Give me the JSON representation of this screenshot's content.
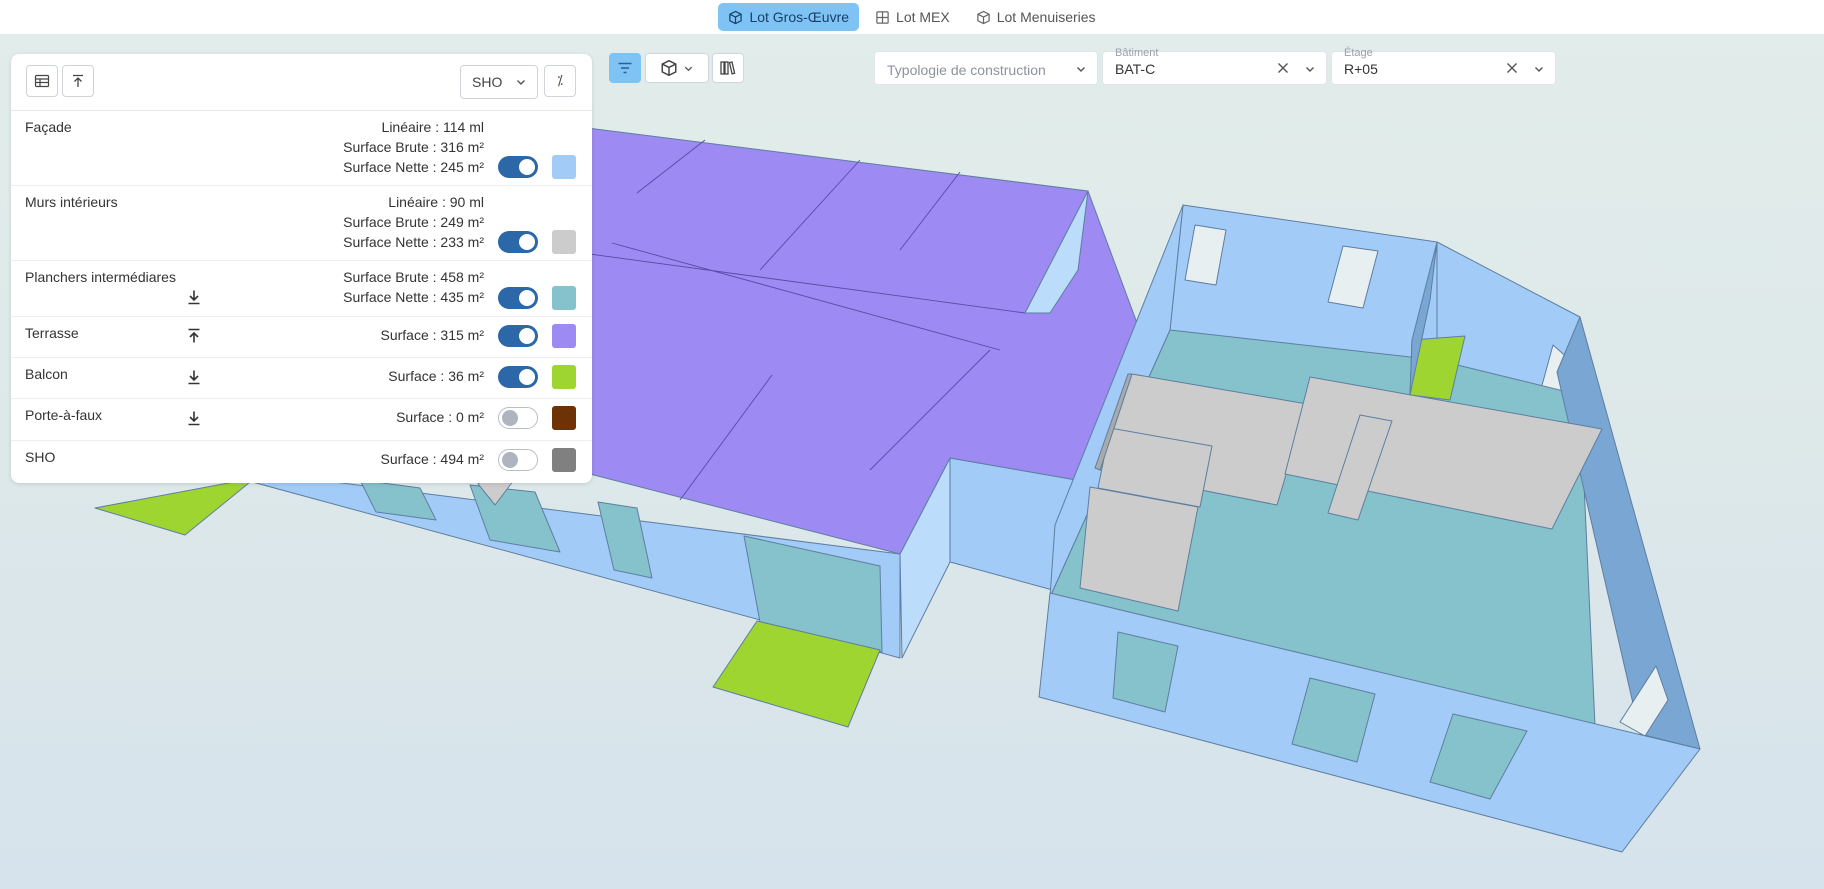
{
  "tabs": [
    {
      "label": "Lot Gros-Œuvre",
      "active": true,
      "icon": "cube-icon"
    },
    {
      "label": "Lot MEX",
      "active": false,
      "icon": "grid-icon"
    },
    {
      "label": "Lot Menuiseries",
      "active": false,
      "icon": "cube-icon"
    }
  ],
  "panel": {
    "select_value": "SHO",
    "percent_glyph": "⁒",
    "rows": [
      {
        "label": "Façade",
        "metrics": [
          "Linéaire : 114 ml",
          "Surface Brute : 316 m²",
          "Surface Nette : 245 m²"
        ],
        "toggle": true,
        "color": "#a3cbf8",
        "extra": ""
      },
      {
        "label": "Murs intérieurs",
        "metrics": [
          "Linéaire : 90 ml",
          "Surface Brute : 249 m²",
          "Surface Nette : 233 m²"
        ],
        "toggle": true,
        "color": "#cccccc",
        "extra": ""
      },
      {
        "label": "Planchers intermédiares",
        "metrics": [
          "Surface Brute : 458 m²",
          "Surface Nette : 435 m²"
        ],
        "toggle": true,
        "color": "#86c2cc",
        "extra": "download-icon"
      },
      {
        "label": "Terrasse",
        "metrics": [
          "Surface : 315 m²"
        ],
        "toggle": true,
        "color": "#9d8af2",
        "extra": "upload-icon"
      },
      {
        "label": "Balcon",
        "metrics": [
          "Surface : 36 m²"
        ],
        "toggle": true,
        "color": "#9fd531",
        "extra": "download-icon"
      },
      {
        "label": "Porte-à-faux",
        "metrics": [
          "Surface : 0 m²"
        ],
        "toggle": false,
        "color": "#6d3205",
        "extra": "download-icon"
      },
      {
        "label": "SHO",
        "metrics": [
          "Surface : 494 m²"
        ],
        "toggle": false,
        "color": "#808080",
        "extra": ""
      }
    ]
  },
  "filters": {
    "typologie": {
      "placeholder": "Typologie de construction"
    },
    "batiment": {
      "label": "Bâtiment",
      "value": "BAT-C"
    },
    "etage": {
      "label": "Étage",
      "value": "R+05"
    }
  },
  "colors": {
    "facade": "#a3cbf8",
    "facade_dark": "#7aa6d4",
    "terrasse": "#9d8af2",
    "plancher": "#86c2cc",
    "balcon": "#9fd531",
    "murs": "#cccccc",
    "accent": "#7fc3f4"
  }
}
